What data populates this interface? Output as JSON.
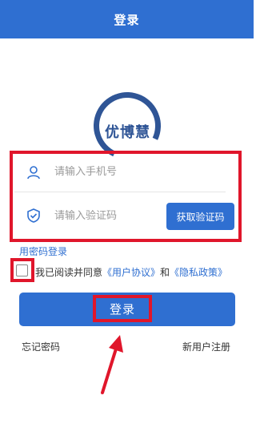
{
  "header": {
    "title": "登录"
  },
  "logo": {
    "text": "优博慧"
  },
  "form": {
    "phone_placeholder": "请输入手机号",
    "code_placeholder": "请输入验证码",
    "get_code_label": "获取验证码"
  },
  "password_login_link": "用密码登录",
  "agreement": {
    "prefix": "我已阅读并同意",
    "user_agreement": "《用户协议》",
    "and": "和",
    "privacy_policy": "《隐私政策》",
    "checked": false
  },
  "login_button": "登录",
  "footer": {
    "forgot_password": "忘记密码",
    "register": "新用户注册"
  },
  "colors": {
    "primary": "#2f6fd1",
    "annotation_red": "#e0162b",
    "logo_blue": "#2f5596"
  },
  "icons": [
    "user-icon",
    "shield-check-icon"
  ]
}
